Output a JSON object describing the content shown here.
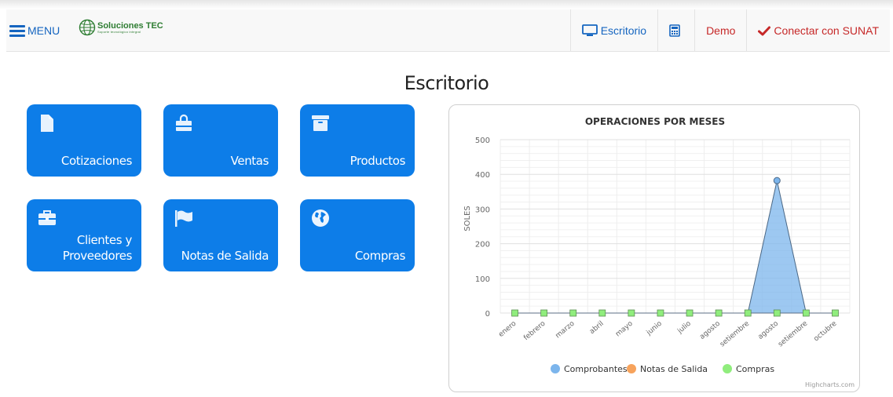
{
  "header": {
    "menu_label": "MENU",
    "logo_title": "Soluciones TEC",
    "logo_subtitle": "Soporte tecnológico integral",
    "nav_escritorio": "Escritorio",
    "nav_demo": "Demo",
    "nav_sunat": "Conectar con SUNAT"
  },
  "page": {
    "title": "Escritorio"
  },
  "tiles": [
    {
      "label_1": "Cotizaciones",
      "label_2": "",
      "icon": "file-icon"
    },
    {
      "label_1": "Ventas",
      "label_2": "",
      "icon": "shopping-bag-icon"
    },
    {
      "label_1": "Productos",
      "label_2": "",
      "icon": "archive-box-icon"
    },
    {
      "label_1": "Clientes y",
      "label_2": "Proveedores",
      "icon": "briefcase-icon"
    },
    {
      "label_1": "Notas de Salida",
      "label_2": "",
      "icon": "flag-icon"
    },
    {
      "label_1": "Compras",
      "label_2": "",
      "icon": "globe-icon"
    }
  ],
  "colors": {
    "primary": "#0d7de8",
    "nav_blue": "#1565c0",
    "nav_red": "#c62828",
    "brand_green": "#2e7d32"
  },
  "chart_data": {
    "type": "area",
    "title": "OPERACIONES POR MESES",
    "ylabel": "SOLES",
    "xlabel": "",
    "ylim": [
      0,
      500
    ],
    "yticks": [
      0,
      100,
      200,
      300,
      400,
      500
    ],
    "categories": [
      "enero",
      "febrero",
      "marzo",
      "abril",
      "mayo",
      "junio",
      "julio",
      "agosto",
      "setiembre",
      "agosto",
      "setiembre",
      "octubre"
    ],
    "series": [
      {
        "name": "Comprobantes",
        "color": "#7cb5ec",
        "values": [
          0,
          0,
          0,
          0,
          0,
          0,
          0,
          0,
          0,
          382,
          0,
          0
        ]
      },
      {
        "name": "Notas de Salida",
        "color": "#f7a35c",
        "values": [
          0,
          0,
          0,
          0,
          0,
          0,
          0,
          0,
          0,
          0,
          0,
          0
        ]
      },
      {
        "name": "Compras",
        "color": "#90ed7d",
        "values": [
          0,
          0,
          0,
          0,
          0,
          0,
          0,
          0,
          0,
          0,
          0,
          0
        ]
      }
    ],
    "credits": "Highcharts.com"
  }
}
